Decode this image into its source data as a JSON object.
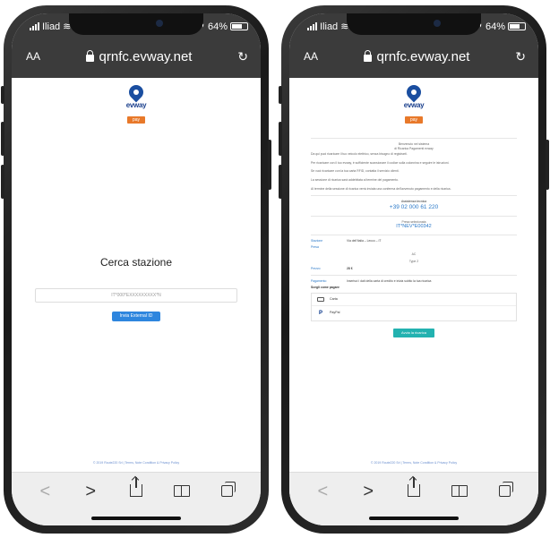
{
  "status": {
    "carrier": "Iliad",
    "battery": "64%"
  },
  "browser": {
    "aa": "AA",
    "url": "qrnfc.evway.net",
    "reload": "↻"
  },
  "toolbar": {
    "back": "<",
    "forward": ">"
  },
  "left_page": {
    "logo_word": "evway",
    "logo_pay": "pay",
    "title": "Cerca stazione",
    "input_placeholder": "IT*000*EXXXXXXXXX*N",
    "submit_label": "Invia External ID",
    "footer": "© 2019 Route220 Srl | Terms, Note Condition & Privacy Policy"
  },
  "right_page": {
    "logo_word": "evway",
    "logo_pay": "pay",
    "welcome_title": "Benvenuto nel sistema",
    "welcome_sub": "di Ricarica Pagamenti evway",
    "intro1": "Da qui puoi ricaricare il tuo veicolo elettrico, senza bisogno di registrarti.",
    "intro2": "Per ricaricare con il tuo evway, è sufficiente scansionare il codice sulla colonnina e seguire le istruzioni.",
    "intro3": "Se vuoi ricaricare con la tua carta RFID, contatta il servizio clienti.",
    "intro4": "La sessione di ricarica sarà addebitata al termine del pagamento.",
    "intro5": "Al termine della sessione di ricarica verrà inviata una conferma dell'avvenuto pagamento e della ricarica.",
    "assist_label": "Assistenza tecnica",
    "assist_phone": "+39 02 000 61 220",
    "station_code_label": "Presa selezionata",
    "station_code": "IT*NEV*E00342",
    "address_label": "Stazione",
    "address_value": "Via dell'Italia – Lecco – IT",
    "plug_label": "Presa",
    "plug_value": "AC",
    "plug_type": "Type 2",
    "cost_label": "Prezzo",
    "cost_value": "28 €",
    "payment_label": "Pagamento",
    "payment_note": "Inserisci i dati della carta di credito e inizia subito la tua ricarica",
    "choose_label": "Scegli come pagare",
    "card_label": "Carta",
    "paypal_label": "PayPal",
    "start_label": "Avvia la ricarica",
    "footer": "© 2019 Route220 Srl | Terms, Note Condition & Privacy Policy"
  }
}
